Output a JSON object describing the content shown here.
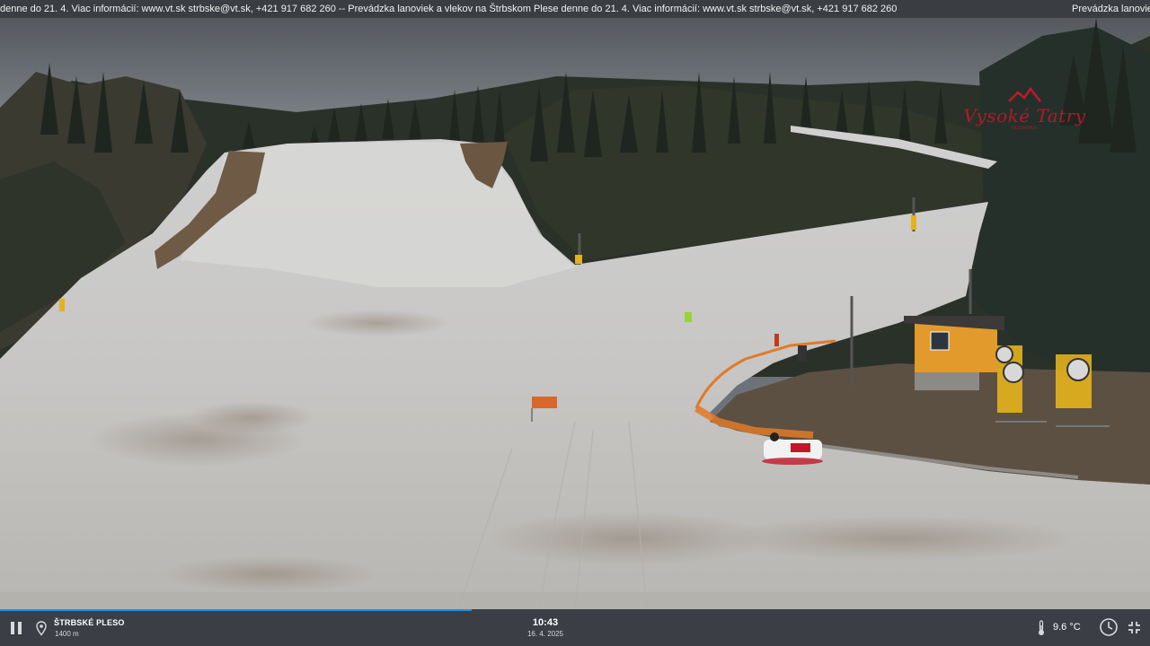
{
  "ticker": {
    "text": "denne do 21. 4. Viac informácií: www.vt.sk strbske@vt.sk, +421 917 682 260 -- Prevádzka lanoviek a vlekov na Štrbskom Plese denne do 21. 4. Viac informácií: www.vt.sk strbske@vt.sk, +421 917 682 260",
    "tail": "Prevádzka lanoviek a vlekov na Štrbskom Plese"
  },
  "overlay": {
    "brand_name": "Vysoké Tatry",
    "brand_sub": "SLOVAKIA"
  },
  "player": {
    "location_name": "ŠTRBSKÉ PLESO",
    "altitude": "1400 m",
    "time": "10:43",
    "date": "16. 4. 2025",
    "temperature": "9.6 °C",
    "progress_percent": 41,
    "controls": {
      "pause": "pause-icon",
      "history": "clock-icon",
      "fullscreen": "exit-fullscreen-icon"
    }
  },
  "colors": {
    "accent": "#1e90e6",
    "bar_bg": "#3b3f45",
    "ticker_bg": "#3a3d42",
    "brand_red": "#c2182b"
  }
}
